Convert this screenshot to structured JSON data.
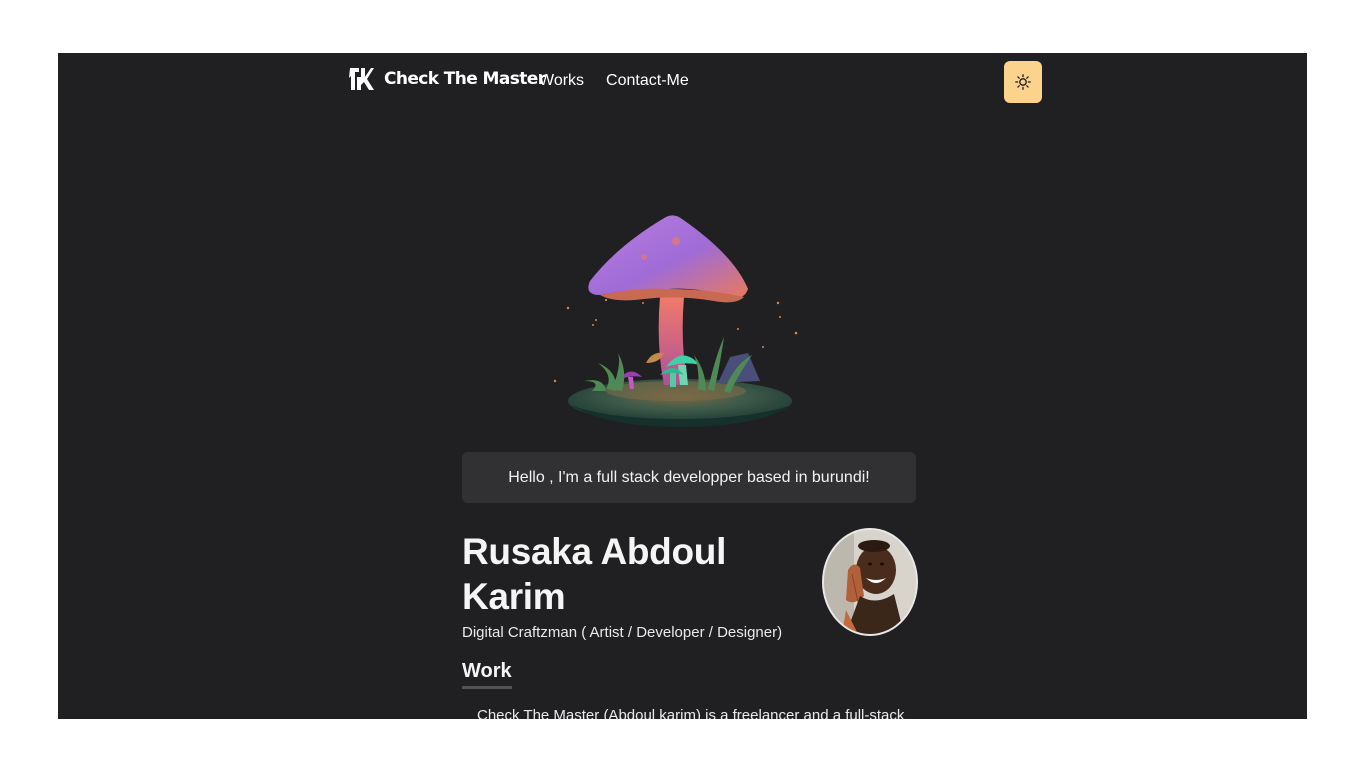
{
  "nav": {
    "brand": "Check The Master",
    "links": [
      "Works",
      "Contact-Me"
    ],
    "theme_icon": "sun-icon",
    "theme_color": "#fbd38d"
  },
  "hero": {
    "illustration": "mushroom-illustration"
  },
  "greeting": "Hello , I'm a full stack developper based in burundi!",
  "profile": {
    "name": "Rusaka Abdoul Karim",
    "role": "Digital Craftzman ( Artist / Developer / Designer)",
    "avatar": "avatar-photo"
  },
  "work": {
    "title": "Work",
    "text": "Check The Master (Abdoul karim) is a freelancer and a full-stack"
  },
  "colors": {
    "background": "#202023",
    "card": "#313134",
    "accent": "#fbd38d"
  }
}
